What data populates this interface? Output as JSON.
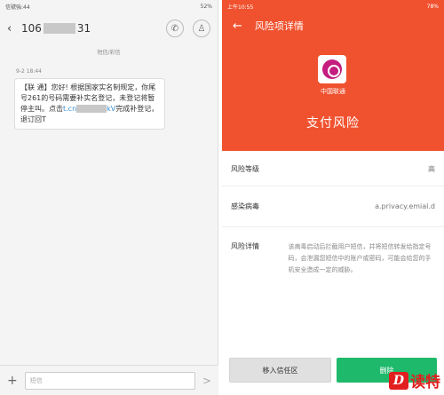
{
  "left_phone": {
    "status_left": "信號強:44",
    "status_right": "52%",
    "contact_prefix": "106",
    "contact_suffix": "31",
    "subtitle": "短信/彩信",
    "message_time": "9-2 18:44",
    "message_part1": "【联 通】您好! 根据国家实名制规定，你尾号261的号码需要补实名登记，未登记将暂停主叫。点击",
    "link_prefix": "t.cn",
    "link_suffix": "kV",
    "message_part2": "完成补登记，退订回T",
    "input_placeholder": "短信",
    "plus_icon": "+",
    "send_icon": ">"
  },
  "right_phone": {
    "status_left": "上午10:55",
    "status_right": "78%",
    "title": "风险项详情",
    "app_name": "中国联通",
    "risk_type": "支付风险",
    "rows": [
      {
        "label": "风险等级",
        "value": "高"
      },
      {
        "label": "感染病毒",
        "value": "a.privacy.emial.d"
      },
      {
        "label": "风险详情",
        "value": "该病毒启动后拦截用户短信，并将短信转发给指定号码，会泄漏您短信中的账户或密码，可能会给您的手机安全造成一定的威胁。"
      }
    ],
    "btn_trust": "移入信任区",
    "btn_delete": "删除"
  },
  "watermark": {
    "logo": "D",
    "text": "读特"
  },
  "colors": {
    "accent": "#f0522f",
    "green": "#1fb96b",
    "link": "#3b8fd6"
  }
}
